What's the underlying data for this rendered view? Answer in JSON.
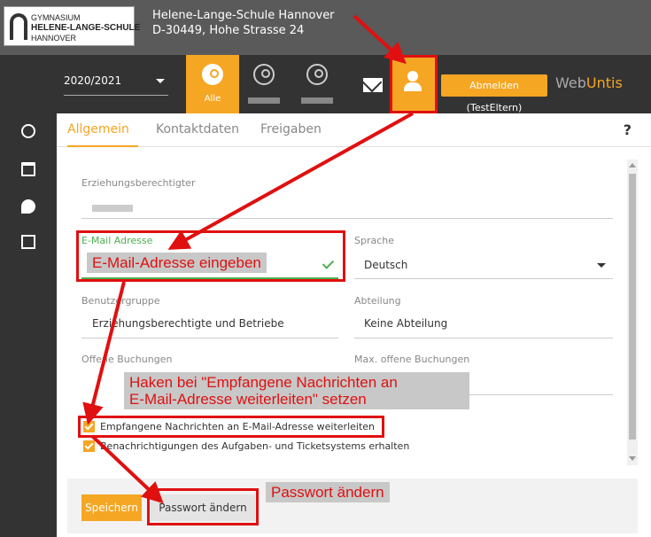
{
  "header": {
    "logo": {
      "line1": "GYMNASIUM",
      "line2": "HELENE-LANGE-SCHULE",
      "line3": "HANNOVER"
    },
    "school_name": "Helene-Lange-Schule Hannover",
    "school_address": "D-30449, Hohe Strasse 24"
  },
  "nav": {
    "school_year": "2020/2021",
    "person_tabs": [
      {
        "label": "Alle",
        "active": true
      },
      {
        "label": "",
        "active": false
      },
      {
        "label": "",
        "active": false
      }
    ],
    "logout_label": "Abmelden (TestEltern)",
    "brand_prefix": "Web",
    "brand_accent": "Untis"
  },
  "tabs": [
    "Allgemein",
    "Kontaktdaten",
    "Freigaben"
  ],
  "help_label": "?",
  "form": {
    "guardian_label": "Erziehungsberechtigter",
    "email_label": "E-Mail Adresse",
    "language_label": "Sprache",
    "language_value": "Deutsch",
    "user_group_label": "Benutzergruppe",
    "user_group_value": "Erziehungsberechtigte und Betriebe",
    "department_label": "Abteilung",
    "department_value": "Keine Abteilung",
    "open_bookings_label": "Offene Buchungen",
    "max_open_bookings_label": "Max. offene Buchungen",
    "checkbox_forward": "Empfangene Nachrichten an E-Mail-Adresse weiterleiten",
    "checkbox_notifications": "Benachrichtigungen des Aufgaben- und Ticketsystems erhalten"
  },
  "footer": {
    "save_label": "Speichern",
    "change_password_label": "Passwort ändern"
  },
  "annotations": {
    "email_hint": "E-Mail-Adresse eingeben",
    "checkbox_hint_line1": "Haken bei \"Empfangene Nachrichten an",
    "checkbox_hint_line2": "E-Mail-Adresse weiterleiten\" setzen",
    "password_hint": "Passwort ändern"
  },
  "colors": {
    "accent": "#f5a623",
    "header_bg": "#5a5a5a",
    "nav_bg": "#333333",
    "valid_green": "#4caf50",
    "annotation_red": "#e01010"
  }
}
